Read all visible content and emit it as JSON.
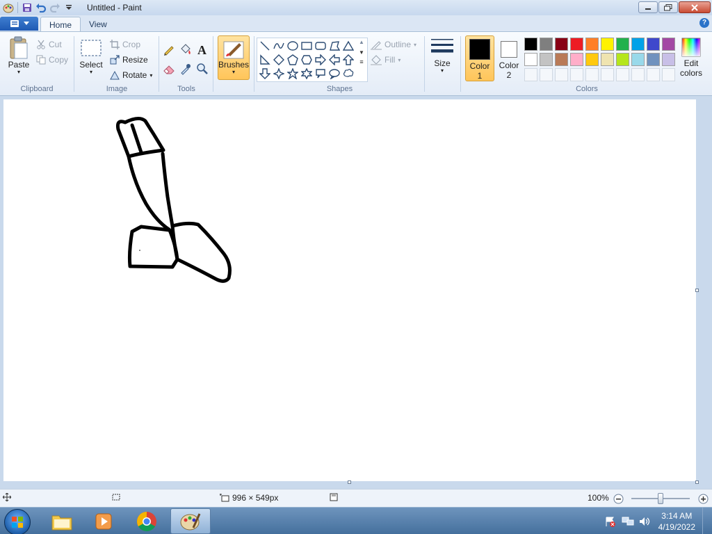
{
  "window": {
    "title": "Untitled - Paint"
  },
  "tabs": [
    {
      "label": "Home",
      "active": true
    },
    {
      "label": "View",
      "active": false
    }
  ],
  "ribbon": {
    "clipboard": {
      "label": "Clipboard",
      "paste": "Paste",
      "cut": "Cut",
      "copy": "Copy"
    },
    "image": {
      "label": "Image",
      "select": "Select",
      "crop": "Crop",
      "resize": "Resize",
      "rotate": "Rotate"
    },
    "tools": {
      "label": "Tools",
      "items": [
        "pencil-icon",
        "fill-icon",
        "text-icon",
        "eraser-icon",
        "color-picker-icon",
        "magnifier-icon"
      ]
    },
    "brushes": {
      "label": "Brushes"
    },
    "shapes": {
      "label": "Shapes",
      "outline": "Outline",
      "fill": "Fill"
    },
    "size": {
      "label": "Size"
    },
    "colors": {
      "label": "Colors",
      "color1_label": "Color",
      "color1_num": "1",
      "color2_label": "Color",
      "color2_num": "2",
      "color1": "#000000",
      "color2": "#ffffff",
      "edit_label_1": "Edit",
      "edit_label_2": "colors",
      "palette_row1": [
        "#000000",
        "#7f7f7f",
        "#880015",
        "#ed1c24",
        "#ff7f27",
        "#fff200",
        "#22b14c",
        "#00a2e8",
        "#3f48cc",
        "#a349a4"
      ],
      "palette_row2": [
        "#ffffff",
        "#c3c3c3",
        "#b97a57",
        "#ffaec9",
        "#ffc90e",
        "#efe4b0",
        "#b5e61d",
        "#99d9ea",
        "#7092be",
        "#c8bfe7"
      ]
    }
  },
  "status": {
    "canvas_size": "996 × 549px",
    "zoom": "100%"
  },
  "taskbar": {
    "time": "3:14 AM",
    "date": "4/19/2022"
  }
}
